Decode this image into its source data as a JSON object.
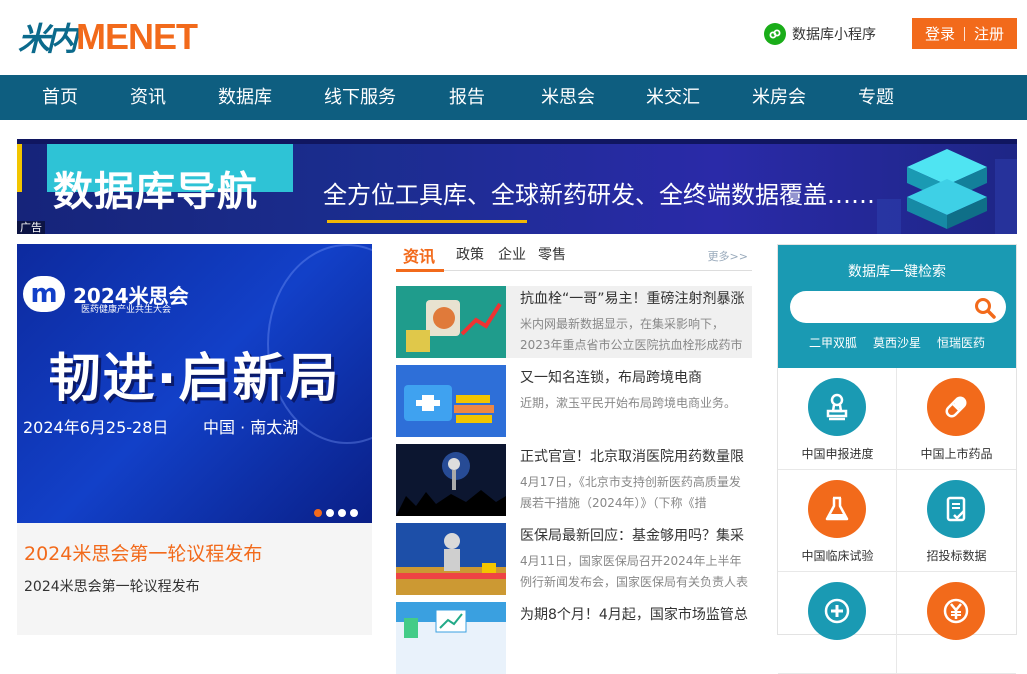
{
  "header": {
    "logo_cn": "米内",
    "logo_en": "MENET",
    "mini_program": "数据库小程序",
    "login": "登录",
    "register": "注册"
  },
  "nav": {
    "items": [
      "首页",
      "资讯",
      "数据库",
      "线下服务",
      "报告",
      "米思会",
      "米交汇",
      "米房会",
      "专题"
    ]
  },
  "banner": {
    "title": "数据库导航",
    "subtitle": "全方位工具库、全球新药研发、全终端数据覆盖……",
    "ad_label": "广告"
  },
  "carousel": {
    "brand": "2024米思会",
    "brand_sub": "医药健康产业共生大会",
    "headline": "韧进·启新局",
    "date": "2024年6月25-28日",
    "location": "中国 · 南太湖",
    "caption_title": "2024米思会第一轮议程发布",
    "caption_desc": "2024米思会第一轮议程发布",
    "active_slide": 1,
    "slide_count": 4
  },
  "news_tabs": {
    "active": "资讯",
    "tabs": [
      "政策",
      "企业",
      "零售"
    ],
    "more": "更多>>"
  },
  "news": [
    {
      "title": "抗血栓“一哥”易主！重磅注射剂暴涨",
      "desc": "米内网最新数据显示，在集采影响下，2023年重点省市公立医院抗血栓形成药市"
    },
    {
      "title": "又一知名连锁，布局跨境电商",
      "desc": "近期，漱玉平民开始布局跨境电商业务。"
    },
    {
      "title": "正式官宣！北京取消医院用药数量限",
      "desc": "4月17日，《北京市支持创新医药高质量发展若干措施（2024年）》（下称《措"
    },
    {
      "title": "医保局最新回应：基金够用吗？集采",
      "desc": "4月11日，国家医保局召开2024年上半年例行新闻发布会，国家医保局有关负责人表"
    },
    {
      "title": "为期8个月！4月起，国家市场监管总",
      "desc": ""
    }
  ],
  "db_search": {
    "title": "数据库一键检索",
    "placeholder": "",
    "tags": [
      "二甲双胍",
      "莫西沙星",
      "恒瑞医药"
    ]
  },
  "db_grid": [
    {
      "label": "中国申报进度",
      "icon": "stamp-icon",
      "color": "#1a9ab3"
    },
    {
      "label": "中国上市药品",
      "icon": "pill-icon",
      "color": "#f26a1b"
    },
    {
      "label": "中国临床试验",
      "icon": "flask-icon",
      "color": "#f26a1b"
    },
    {
      "label": "招投标数据",
      "icon": "document-icon",
      "color": "#1a9ab3"
    },
    {
      "label": "",
      "icon": "plus-icon",
      "color": "#1a9ab3"
    },
    {
      "label": "",
      "icon": "yuan-icon",
      "color": "#f26a1b"
    }
  ]
}
